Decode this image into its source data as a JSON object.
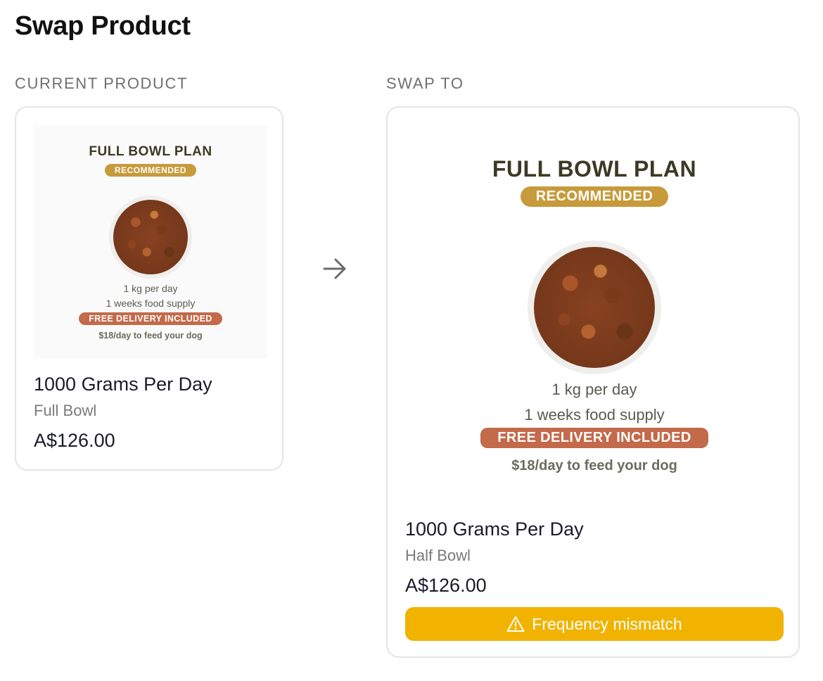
{
  "page": {
    "title": "Swap Product"
  },
  "sections": {
    "current_label": "CURRENT PRODUCT",
    "swap_label": "SWAP TO"
  },
  "current_product": {
    "image": {
      "plan_title": "FULL BOWL PLAN",
      "badge": "RECOMMENDED",
      "line1": "1 kg per day",
      "line2": "1 weeks food supply",
      "delivery": "FREE DELIVERY INCLUDED",
      "cost": "$18/day to feed your dog"
    },
    "name": "1000 Grams Per Day",
    "variant": "Full Bowl",
    "price": "A$126.00"
  },
  "swap_product": {
    "image": {
      "plan_title": "FULL BOWL PLAN",
      "badge": "RECOMMENDED",
      "line1": "1 kg per day",
      "line2": "1 weeks food supply",
      "delivery": "FREE DELIVERY INCLUDED",
      "cost": "$18/day to feed your dog"
    },
    "name": "1000 Grams Per Day",
    "variant": "Half Bowl",
    "price": "A$126.00",
    "warning_label": "Frequency mismatch"
  },
  "icons": {
    "arrow": "arrow-right-icon",
    "warning": "warning-triangle-icon"
  },
  "colors": {
    "warning_bg": "#f1b300",
    "badge": "#c79a3a",
    "delivery": "#c26a4a"
  }
}
